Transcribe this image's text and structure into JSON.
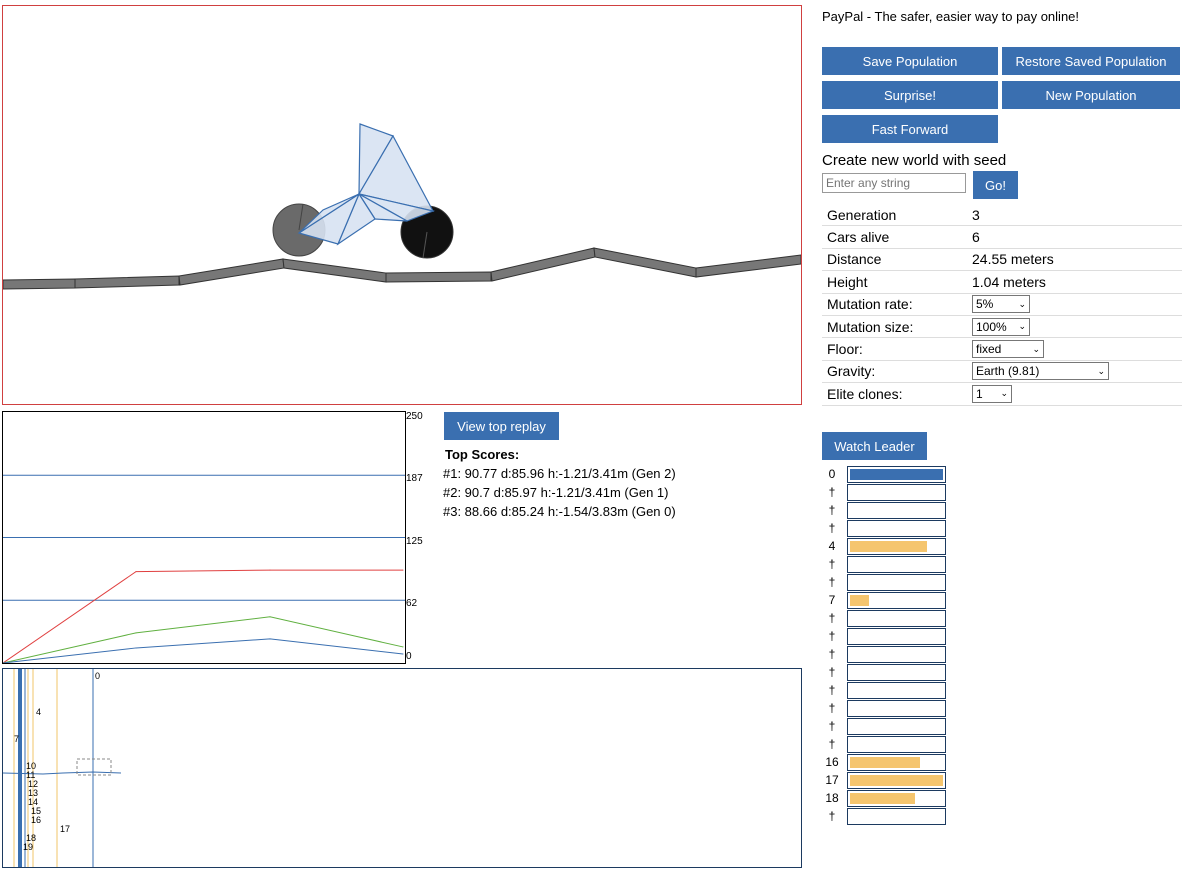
{
  "header": {
    "paypal_text": "PayPal - The safer, easier way to pay online!"
  },
  "buttons": {
    "save_population": "Save Population",
    "restore_saved_population": "Restore Saved Population",
    "surprise": "Surprise!",
    "new_population": "New Population",
    "fast_forward": "Fast Forward",
    "go": "Go!",
    "view_top_replay": "View top replay",
    "watch_leader": "Watch Leader"
  },
  "seed": {
    "label": "Create new world with seed",
    "placeholder": "Enter any string"
  },
  "stats": {
    "generation": {
      "label": "Generation",
      "value": "3"
    },
    "cars_alive": {
      "label": "Cars alive",
      "value": "6"
    },
    "distance": {
      "label": "Distance",
      "value": "24.55 meters"
    },
    "height": {
      "label": "Height",
      "value": "1.04 meters"
    },
    "mutation_rate": {
      "label": "Mutation rate:",
      "value": "5%"
    },
    "mutation_size": {
      "label": "Mutation size:",
      "value": "100%"
    },
    "floor": {
      "label": "Floor:",
      "value": "fixed"
    },
    "gravity": {
      "label": "Gravity:",
      "value": "Earth (9.81)"
    },
    "elite_clones": {
      "label": "Elite clones:",
      "value": "1"
    }
  },
  "graph": {
    "ticks": [
      "250",
      "187",
      "125",
      "62",
      "0"
    ],
    "colors": {
      "top": "#e04040",
      "average": "#60b040",
      "bottom": "#3a6fb0",
      "grid": "#3a6fb0"
    }
  },
  "chart_data": {
    "type": "line",
    "x": [
      0,
      1,
      2,
      3
    ],
    "ylim": [
      0,
      250
    ],
    "series": [
      {
        "values": [
          0,
          91,
          92.5,
          92.5
        ]
      },
      {
        "values": [
          0,
          30,
          46,
          16
        ]
      },
      {
        "values": [
          0,
          15,
          24,
          9
        ]
      }
    ]
  },
  "top_scores": {
    "title": "Top Scores:",
    "entries": [
      "#1: 90.77 d:85.96 h:-1.21/3.41m (Gen 2)",
      "#2: 90.7 d:85.97 h:-1.21/3.41m (Gen 1)",
      "#3: 88.66 d:85.24 h:-1.54/3.83m (Gen 0)"
    ]
  },
  "health_bars": [
    {
      "label": "0",
      "fill": 1.0,
      "color": "#3a6fb0"
    },
    {
      "label": "†",
      "fill": 0
    },
    {
      "label": "†",
      "fill": 0
    },
    {
      "label": "†",
      "fill": 0
    },
    {
      "label": "4",
      "fill": 0.83,
      "color": "#f5c56e"
    },
    {
      "label": "†",
      "fill": 0
    },
    {
      "label": "†",
      "fill": 0
    },
    {
      "label": "7",
      "fill": 0.2,
      "color": "#f5c56e"
    },
    {
      "label": "†",
      "fill": 0
    },
    {
      "label": "†",
      "fill": 0
    },
    {
      "label": "†",
      "fill": 0
    },
    {
      "label": "†",
      "fill": 0
    },
    {
      "label": "†",
      "fill": 0
    },
    {
      "label": "†",
      "fill": 0
    },
    {
      "label": "†",
      "fill": 0
    },
    {
      "label": "†",
      "fill": 0
    },
    {
      "label": "16",
      "fill": 0.75,
      "color": "#f5c56e"
    },
    {
      "label": "17",
      "fill": 1.0,
      "color": "#f5c56e"
    },
    {
      "label": "18",
      "fill": 0.7,
      "color": "#f5c56e"
    },
    {
      "label": "†",
      "fill": 0
    }
  ],
  "minimap": {
    "labels": [
      "0",
      "4",
      "7",
      "10",
      "11",
      "12",
      "13",
      "14",
      "15",
      "16",
      "17",
      "18",
      "19"
    ]
  }
}
